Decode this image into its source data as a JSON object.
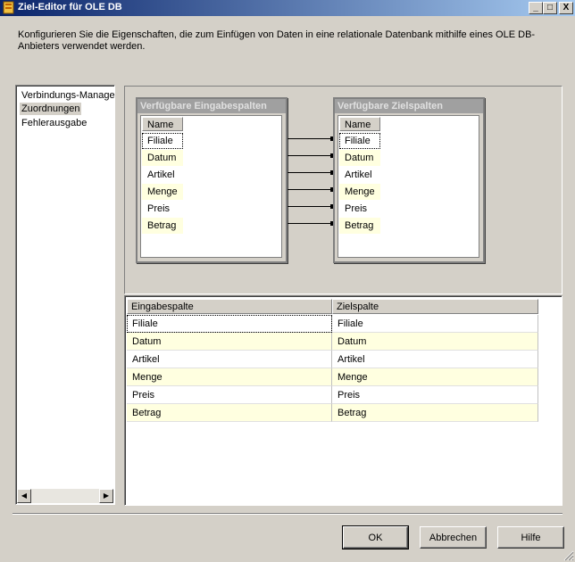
{
  "window": {
    "title": "Ziel-Editor für OLE DB",
    "controls": {
      "minimize": "_",
      "maximize": "□",
      "close": "X"
    }
  },
  "description": "Konfigurieren Sie die Eigenschaften, die zum Einfügen von Daten in eine relationale Datenbank mithilfe eines OLE DB-Anbieters verwendet werden.",
  "nav": {
    "items": [
      {
        "label": "Verbindungs-Manage",
        "selected": false
      },
      {
        "label": "Zuordnungen",
        "selected": true
      },
      {
        "label": "Fehlerausgabe",
        "selected": false
      }
    ]
  },
  "input_table": {
    "title": "Verfügbare Eingabespalten",
    "column_header": "Name",
    "columns": [
      "Filiale",
      "Datum",
      "Artikel",
      "Menge",
      "Preis",
      "Betrag"
    ]
  },
  "target_table": {
    "title": "Verfügbare Zielspalten",
    "column_header": "Name",
    "columns": [
      "Filiale",
      "Datum",
      "Artikel",
      "Menge",
      "Preis",
      "Betrag"
    ]
  },
  "grid": {
    "headers": [
      "Eingabespalte",
      "Zielspalte"
    ],
    "rows": [
      [
        "Filiale",
        "Filiale"
      ],
      [
        "Datum",
        "Datum"
      ],
      [
        "Artikel",
        "Artikel"
      ],
      [
        "Menge",
        "Menge"
      ],
      [
        "Preis",
        "Preis"
      ],
      [
        "Betrag",
        "Betrag"
      ]
    ]
  },
  "buttons": {
    "ok": "OK",
    "cancel": "Abbrechen",
    "help": "Hilfe"
  },
  "colors": {
    "titlebar_start": "#0a246a",
    "titlebar_end": "#a6caf0",
    "alt_row": "#ffffe0",
    "face": "#d4d0c8"
  }
}
